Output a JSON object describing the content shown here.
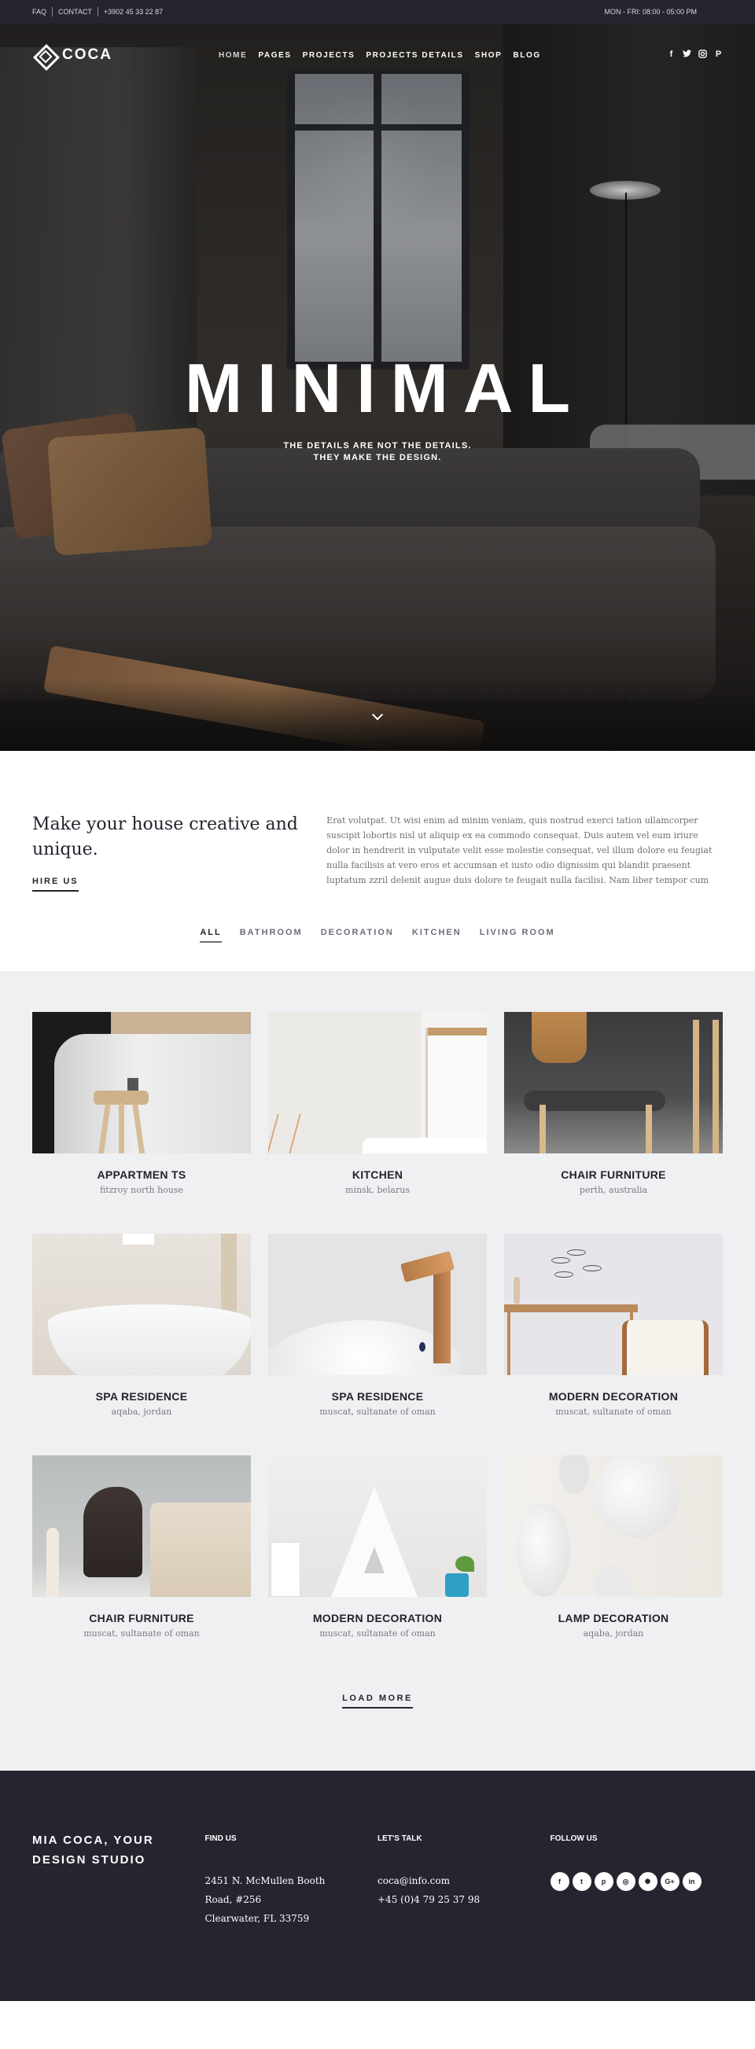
{
  "topbar": {
    "links": [
      "FAQ",
      "CONTACT"
    ],
    "phone": "+3902 45 33 22 87",
    "hours": "MON - FRI: 08:00 - 05:00 PM"
  },
  "nav": {
    "brand": "COCA",
    "items": [
      {
        "label": "HOME",
        "active": true
      },
      {
        "label": "PAGES"
      },
      {
        "label": "PROJECTS"
      },
      {
        "label": "PROJECTS DETAILS"
      },
      {
        "label": "SHOP"
      },
      {
        "label": "BLOG"
      }
    ],
    "social": [
      {
        "icon": "facebook-icon",
        "glyph": "f"
      },
      {
        "icon": "twitter-icon",
        "glyph": "🐦"
      },
      {
        "icon": "instagram-icon",
        "glyph": "◎"
      },
      {
        "icon": "pinterest-icon",
        "glyph": "P"
      }
    ]
  },
  "hero": {
    "title": "MINIMAL",
    "subtitle_line1": "THE DETAILS ARE NOT THE DETAILS.",
    "subtitle_line2": "THEY MAKE THE DESIGN.",
    "scroll_icon": "chevron-down-icon"
  },
  "intro": {
    "heading": "Make your house creative and unique.",
    "cta": "HIRE US",
    "body": "Erat volutpat. Ut wisi enim ad minim veniam, quis nostrud exerci tation ullamcorper suscipit lobortis nisl ut aliquip ex ea commodo consequat. Duis autem vel eum iriure dolor in hendrerit in vulputate velit esse molestie consequat, vel illum dolore eu feugiat nulla facilisis at vero eros et accumsan et iusto odio dignissim qui blandit praesent luptatum zzril delenit augue duis dolore te feugait nulla facilisi. Nam liber tempor cum"
  },
  "filters": [
    {
      "label": "ALL",
      "active": true
    },
    {
      "label": "BATHROOM"
    },
    {
      "label": "DECORATION"
    },
    {
      "label": "KITCHEN"
    },
    {
      "label": "LIVING ROOM"
    }
  ],
  "projects": [
    {
      "title": "APPARTMEN TS",
      "location": "fitzroy north house"
    },
    {
      "title": "KITCHEN",
      "location": "minsk, belarus"
    },
    {
      "title": "CHAIR FURNITURE",
      "location": "perth, australia"
    },
    {
      "title": "SPA RESIDENCE",
      "location": "aqaba, jordan"
    },
    {
      "title": "SPA RESIDENCE",
      "location": "muscat, sultanate of oman"
    },
    {
      "title": "MODERN DECORATION",
      "location": "muscat, sultanate of oman"
    },
    {
      "title": "CHAIR FURNITURE",
      "location": "muscat, sultanate of oman"
    },
    {
      "title": "MODERN DECORATION",
      "location": "muscat, sultanate of oman"
    },
    {
      "title": "LAMP DECORATION",
      "location": "aqaba, jordan"
    }
  ],
  "load_more": "LOAD MORE",
  "footer": {
    "brand": "MIA COCA, YOUR DESIGN STUDIO",
    "find_us": {
      "heading": "FIND US",
      "line1": "2451 N. McMullen Booth",
      "line2": "Road, #256",
      "line3": "Clearwater, FL 33759"
    },
    "lets_talk": {
      "heading": "LET'S TALK",
      "email": "coca@info.com",
      "phone": "+45 (0)4 79 25 37 98"
    },
    "follow_us": {
      "heading": "FOLLOW US",
      "icons": [
        {
          "icon": "facebook-icon",
          "glyph": "f"
        },
        {
          "icon": "twitter-icon",
          "glyph": "t"
        },
        {
          "icon": "pinterest-icon",
          "glyph": "p"
        },
        {
          "icon": "instagram-icon",
          "glyph": "◎"
        },
        {
          "icon": "dribbble-icon",
          "glyph": "✺"
        },
        {
          "icon": "google-plus-icon",
          "glyph": "G+"
        },
        {
          "icon": "linkedin-icon",
          "glyph": "in"
        }
      ]
    }
  },
  "colors": {
    "dark": "#24252f",
    "text_dark": "#23232d",
    "muted": "#6e6f78",
    "portfolio_bg": "#eff0f2"
  }
}
